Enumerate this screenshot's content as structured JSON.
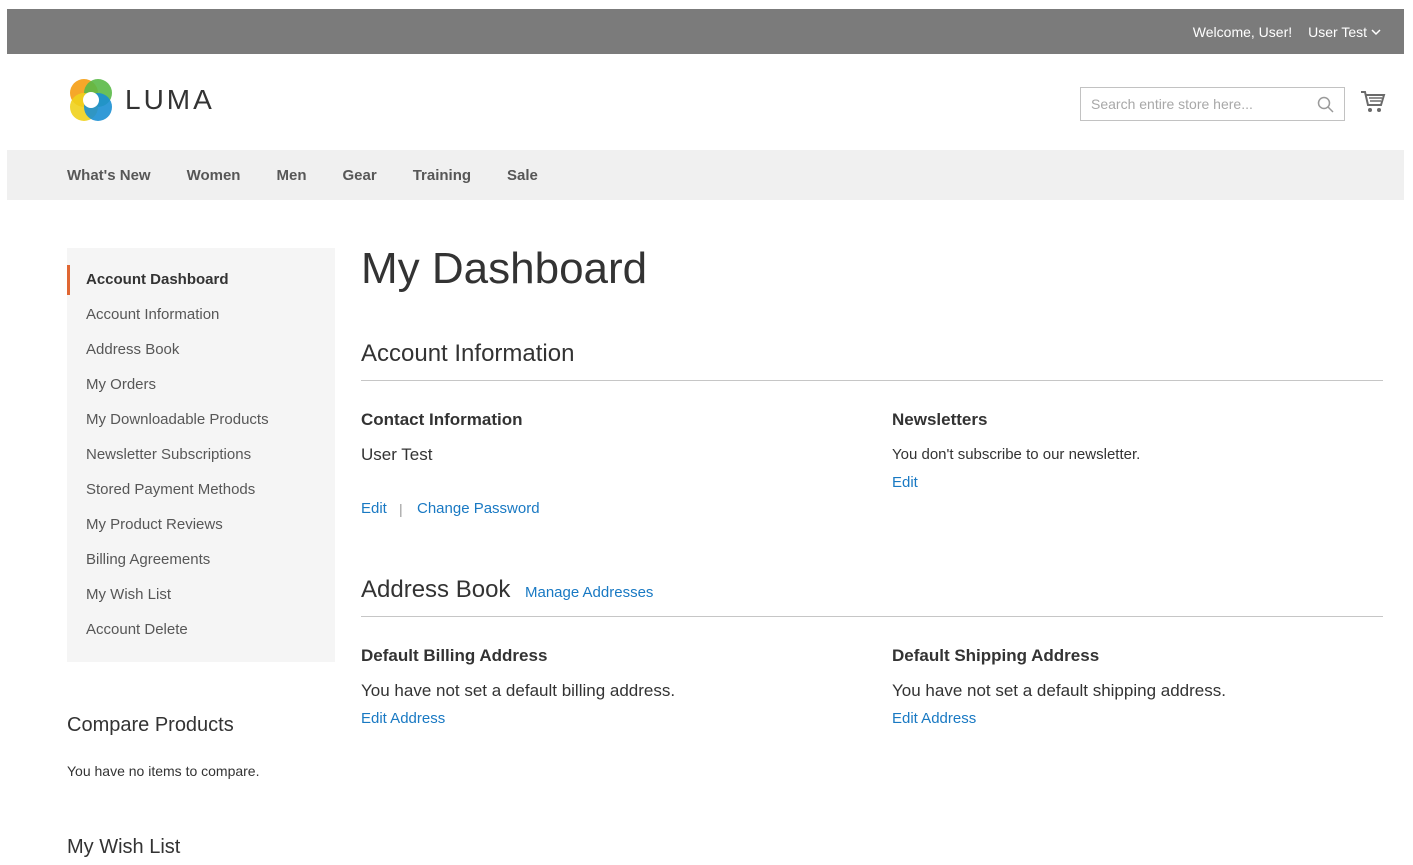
{
  "topbar": {
    "welcome": "Welcome, User!",
    "account_label": "User Test",
    "chevron_icon": "chevron-down-icon"
  },
  "header": {
    "logo_text": "LUMA",
    "search_placeholder": "Search entire store here...",
    "search_icon": "search-icon",
    "cart_icon": "cart-icon"
  },
  "nav": {
    "items": [
      "What's New",
      "Women",
      "Men",
      "Gear",
      "Training",
      "Sale"
    ]
  },
  "sidebar": {
    "active_index": 0,
    "items": [
      "Account Dashboard",
      "Account Information",
      "Address Book",
      "My Orders",
      "My Downloadable Products",
      "Newsletter Subscriptions",
      "Stored Payment Methods",
      "My Product Reviews",
      "Billing Agreements",
      "My Wish List",
      "Account Delete"
    ]
  },
  "compare": {
    "title": "Compare Products",
    "text": "You have no items to compare."
  },
  "wishlist": {
    "title": "My Wish List"
  },
  "main": {
    "page_title": "My Dashboard",
    "account_info": {
      "title": "Account Information",
      "contact": {
        "title": "Contact Information",
        "name": "User Test",
        "edit_label": "Edit",
        "separator": "|",
        "change_password_label": "Change Password"
      },
      "newsletters": {
        "title": "Newsletters",
        "text": "You don't subscribe to our newsletter.",
        "edit_label": "Edit"
      }
    },
    "address_book": {
      "title": "Address Book",
      "manage_label": "Manage Addresses",
      "billing": {
        "title": "Default Billing Address",
        "text": "You have not set a default billing address.",
        "edit_label": "Edit Address"
      },
      "shipping": {
        "title": "Default Shipping Address",
        "text": "You have not set a default shipping address.",
        "edit_label": "Edit Address"
      }
    }
  },
  "colors": {
    "topbar_bg": "#7b7b7b",
    "nav_bg": "#f0f0f0",
    "sidebar_bg": "#f5f5f5",
    "active_accent": "#e06733",
    "link": "#1979c3"
  }
}
